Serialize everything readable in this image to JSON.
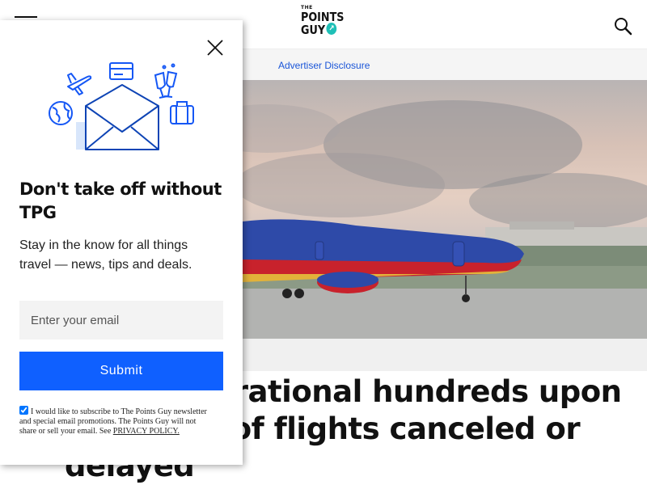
{
  "header": {
    "logo": {
      "line1": "THE",
      "line2": "POINTS",
      "line3": "GUY"
    },
    "menu_icon": "hamburger-menu-icon",
    "search_icon": "search-icon"
  },
  "disclosure": {
    "label": "Advertiser Disclosure"
  },
  "article": {
    "headline": "uffers operational hundreds upon hundreds of flights canceled or delayed"
  },
  "modal": {
    "title": "Don't take off without TPG",
    "text": "Stay in the know for all things travel — news, tips and deals.",
    "email_placeholder": "Enter your email",
    "submit_label": "Submit",
    "consent_text": "I would like to subscribe to The Points Guy newsletter and special email promotions. The Points Guy will not share or sell your email. See ",
    "privacy_link": "PRIVACY POLICY.",
    "consent_checked": true
  },
  "colors": {
    "accent": "#0f60ff",
    "link": "#1a55d8",
    "logo_dot": "#1fc0b7",
    "southwest_blue": "#2e4aa8",
    "southwest_red": "#c8222c"
  }
}
